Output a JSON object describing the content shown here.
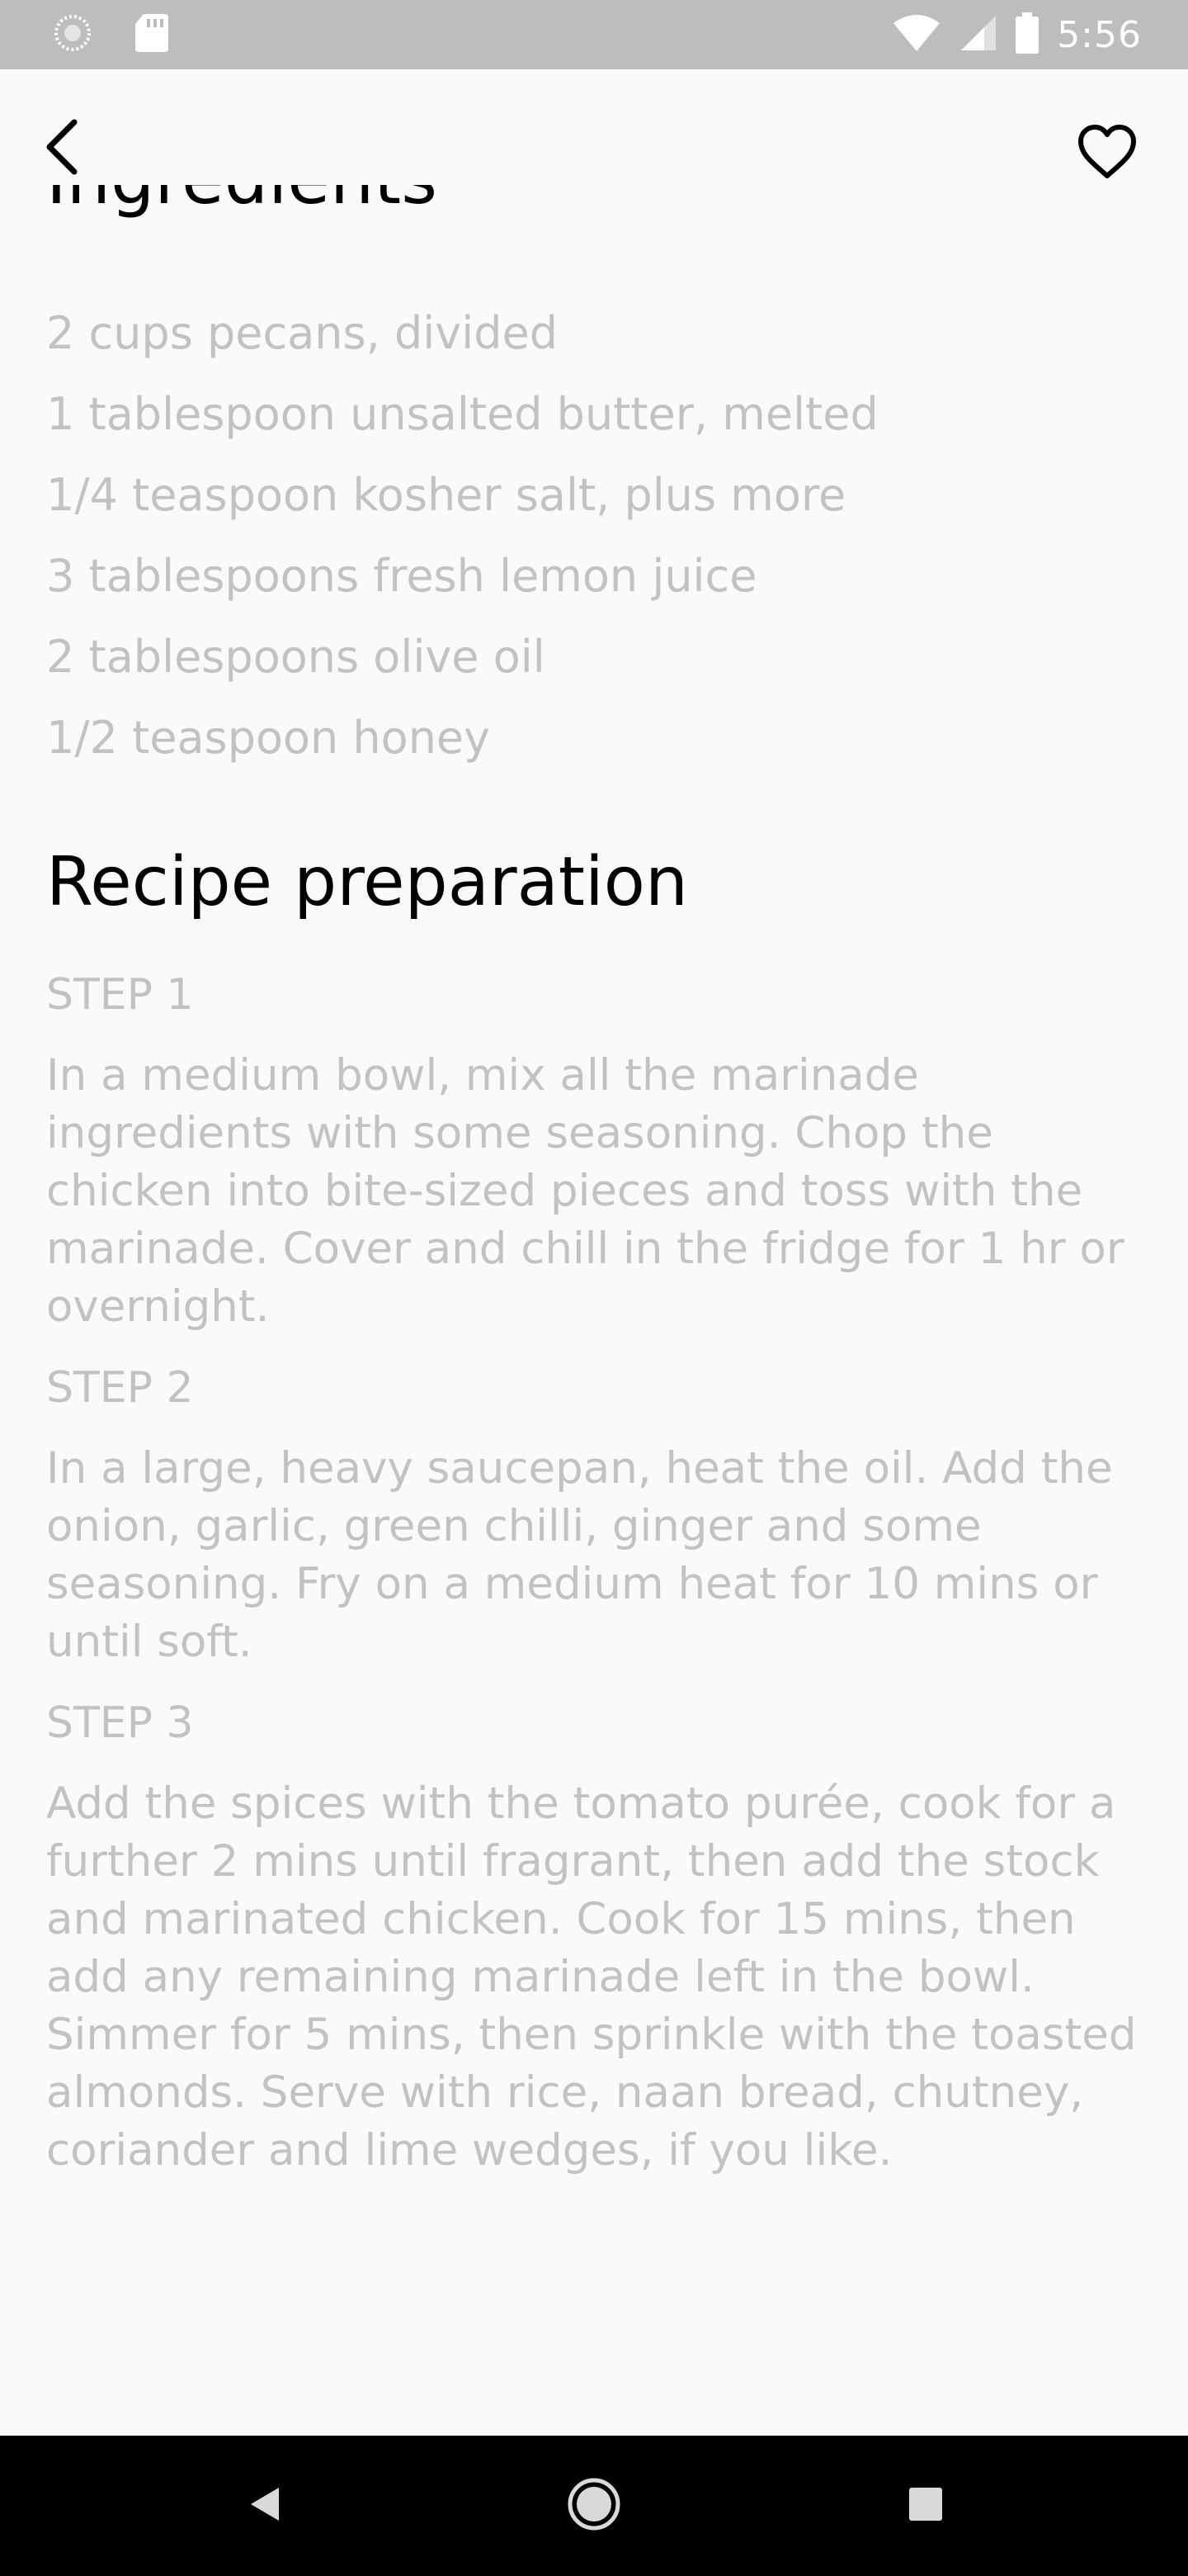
{
  "status_bar": {
    "time": "5:56"
  },
  "app_bar": {
    "back_icon": "back-arrow-icon",
    "favorite_icon": "heart-outline-icon"
  },
  "ingredients": {
    "title": "Ingredients",
    "items": [
      "2 cups pecans, divided",
      "1 tablespoon unsalted butter, melted",
      "1/4 teaspoon kosher salt, plus more",
      "3 tablespoons fresh lemon juice",
      "2 tablespoons olive oil",
      "1/2 teaspoon honey"
    ]
  },
  "preparation": {
    "title": "Recipe preparation",
    "steps": [
      {
        "label": "STEP 1",
        "text": "In a medium bowl, mix all the marinade ingredients with some seasoning. Chop the chicken into bite-sized pieces and toss with the marinade. Cover and chill in the fridge for 1 hr or overnight."
      },
      {
        "label": "STEP 2",
        "text": "In a large, heavy saucepan, heat the oil. Add the onion, garlic, green chilli, ginger and some seasoning. Fry on a medium heat for 10 mins or until soft."
      },
      {
        "label": "STEP 3",
        "text": "Add the spices with the tomato purée, cook for a further 2 mins until fragrant, then add the stock and marinated chicken. Cook for 15 mins, then add any remaining marinade left in the bowl. Simmer for 5 mins, then sprinkle with the toasted almonds. Serve with rice, naan bread, chutney, coriander and lime wedges, if you like."
      }
    ]
  },
  "colors": {
    "status_bar": "#bdbdbd",
    "muted_text": "#c2c2c2",
    "heading_text": "#000000",
    "background": "#fafafa",
    "nav_bar": "#000000"
  }
}
